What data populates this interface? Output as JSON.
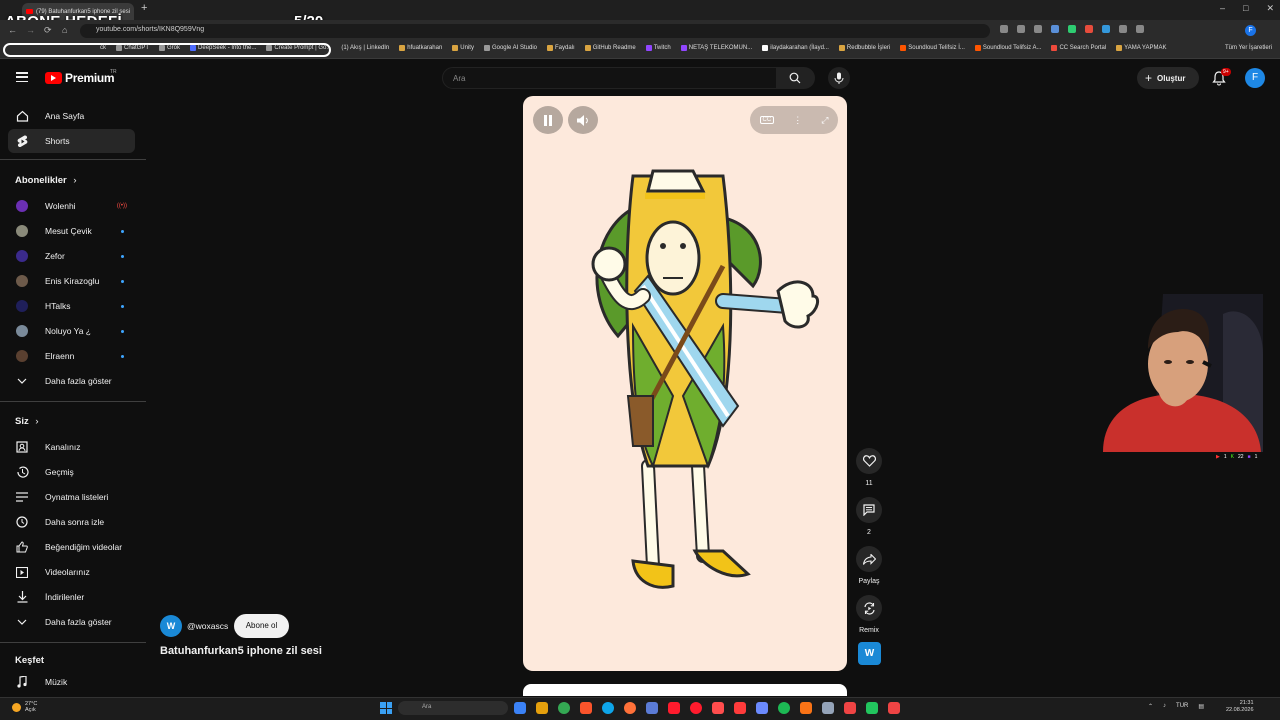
{
  "browser": {
    "tab_title": "(79) Batuhanfurkan5 iphone zil sesi",
    "url": "youtube.com/shorts/IKN8Q959Vng",
    "bookmarks": [
      "ck",
      "ChatGPT",
      "Grok",
      "DeepSeek - Into the...",
      "Create Prompt | Go...",
      "(1) Akış | LinkedIn",
      "hfuatkarahan",
      "Unity",
      "Google AI Studio",
      "Faydalı",
      "GitHub Readme",
      "Twitch",
      "NETAŞ TELEKOMUN...",
      "ilaydakarahan (İlayd...",
      "Redbubble İşleri",
      "Soundloud Telifsiz İ...",
      "Soundloud Telifsiz A...",
      "CC Search Portal",
      "YAMA YAPMAK"
    ],
    "all_bookmarks": "Tüm Yer İşaretleri",
    "profile_initial": "F"
  },
  "stream_overlay": {
    "title": "ABONE HEDEFİ",
    "counter": "5/20"
  },
  "header": {
    "logo_text": "Premium",
    "region": "TR",
    "search_placeholder": "Ara",
    "create_label": "Oluştur",
    "notif_count": "9+",
    "avatar_initial": "F"
  },
  "sidebar": {
    "main": [
      {
        "label": "Ana Sayfa",
        "icon": "home-icon"
      },
      {
        "label": "Shorts",
        "icon": "shorts-icon",
        "active": true
      }
    ],
    "subscriptions_title": "Abonelikler",
    "subscriptions": [
      {
        "label": "Wolenhi",
        "color": "#6b2fb3",
        "status": "live"
      },
      {
        "label": "Mesut Çevik",
        "color": "#8a8a7a",
        "status": "new"
      },
      {
        "label": "Zefor",
        "color": "#3b2a8c",
        "status": "new"
      },
      {
        "label": "Enis Kirazoglu",
        "color": "#6d5a4a",
        "status": "new"
      },
      {
        "label": "HTalks",
        "color": "#1f1f5a",
        "status": "new"
      },
      {
        "label": "Noluyo Ya ¿",
        "color": "#7a8a9a",
        "status": "new"
      },
      {
        "label": "Elraenn",
        "color": "#5a4030",
        "status": "new"
      }
    ],
    "subscriptions_more": "Daha fazla göster",
    "you_title": "Siz",
    "you": [
      {
        "label": "Kanalınız",
        "icon": "channel-icon"
      },
      {
        "label": "Geçmiş",
        "icon": "history-icon"
      },
      {
        "label": "Oynatma listeleri",
        "icon": "playlist-icon"
      },
      {
        "label": "Daha sonra izle",
        "icon": "watch-later-icon"
      },
      {
        "label": "Beğendiğim videolar",
        "icon": "like-icon"
      },
      {
        "label": "Videolarınız",
        "icon": "videos-icon"
      },
      {
        "label": "İndirilenler",
        "icon": "download-icon"
      }
    ],
    "you_more": "Daha fazla göster",
    "explore_title": "Keşfet",
    "explore": [
      {
        "label": "Müzik",
        "icon": "music-icon"
      }
    ]
  },
  "short": {
    "channel_handle": "@woxascs",
    "channel_initial": "W",
    "subscribe_label": "Abone ol",
    "title": "Batuhanfurkan5 iphone zil sesi",
    "cc_label": "CC"
  },
  "actions": {
    "likes": "11",
    "comments": "2",
    "share_label": "Paylaş",
    "remix_label": "Remix"
  },
  "webcam": {
    "stats": [
      "1",
      "22",
      "1"
    ]
  },
  "taskbar": {
    "temp": "27°C",
    "weather": "Açık",
    "search_placeholder": "Ara",
    "lang": "TUR",
    "time": "21:31",
    "date": "22.08.2026"
  }
}
